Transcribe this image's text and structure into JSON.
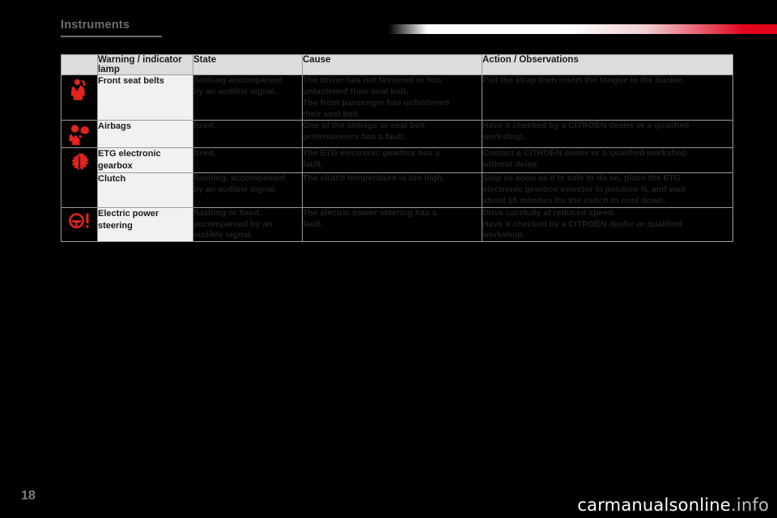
{
  "header": {
    "title": "Instruments"
  },
  "table": {
    "columns": [
      {
        "key": "icon",
        "label": ""
      },
      {
        "key": "lamp",
        "label": "Warning / indicator lamp"
      },
      {
        "key": "state",
        "label": "State"
      },
      {
        "key": "cause",
        "label": "Cause"
      },
      {
        "key": "action",
        "label": "Action / Observations"
      }
    ],
    "rows": [
      {
        "icon": "seat-belt-icon",
        "lamp": "Front seat belts",
        "state": [
          "flashing accompanied",
          "by an audible signal."
        ],
        "cause": [
          "The driver has not fastened or has",
          "unfastened their seat belt.",
          "The front passenger has unfastened",
          "their seat belt."
        ],
        "action": [
          "Pull the strap then insert the tongue in the buckle."
        ]
      },
      {
        "icon": "airbag-icon",
        "lamp": "Airbags",
        "state": [
          "fixed."
        ],
        "cause": [
          "One of the airbags or seat belt",
          "pretensioners has a fault."
        ],
        "action": [
          "Have it checked by a CITROËN dealer or a qualified",
          "workshop."
        ]
      },
      {
        "icon": "gearbox-gear-icon",
        "lamp": "ETG electronic gearbox",
        "state": [
          "fixed."
        ],
        "cause": [
          "The ETG electronic gearbox has a",
          "fault."
        ],
        "action": [
          "Contact a CITROËN dealer or a qualified workshop",
          "without delay."
        ]
      },
      {
        "icon": "",
        "lamp": "Clutch",
        "state": [
          "flashing, accompanied",
          "by an audible signal."
        ],
        "cause": [
          "The clutch temperature is too high."
        ],
        "action": [
          "Stop as soon as it is safe to do so, place the ETG",
          "electronic gearbox selector in position N, and wait",
          "about 15 minutes for the clutch to cool down."
        ]
      },
      {
        "icon": "steering-wheel-icon",
        "lamp": "Electric power steering",
        "state": [
          "flashing or fixed,",
          "accompanied by an",
          "audible signal."
        ],
        "cause": [
          "The electric power steering has a",
          "fault."
        ],
        "action": [
          "Drive carefully at reduced speed.",
          "Have it checked by a CITROËN dealer or qualified",
          "workshop."
        ]
      }
    ]
  },
  "footer": {
    "page_number": "18",
    "watermark": "carmanualsonline",
    "watermark_suffix": ".info"
  },
  "colors": {
    "accent_red": "#e2001a",
    "icon_red": "#e2231f",
    "header_text": "#6d6d6d",
    "table_header_bg": "#dcdcdc",
    "cell_bg_dark": "#000000",
    "cell_bg_light": "#f0f2f2"
  }
}
